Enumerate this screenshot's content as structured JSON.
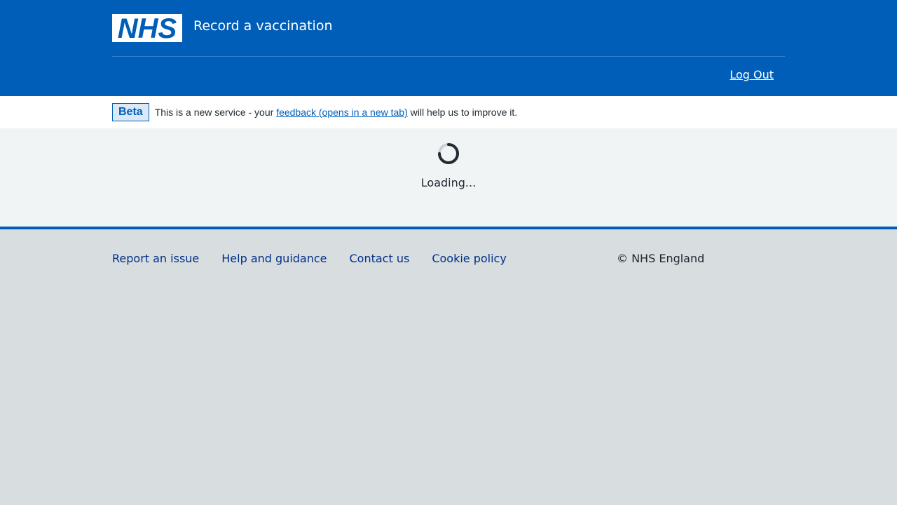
{
  "header": {
    "logo_text": "NHS",
    "service_name": "Record a vaccination",
    "logout_label": "Log Out"
  },
  "beta": {
    "tag": "Beta",
    "text_before": "This is a new service - your ",
    "link_text": "feedback (opens in a new tab)",
    "text_after": " will help us to improve it."
  },
  "main": {
    "loading_text": "Loading..."
  },
  "footer": {
    "links": [
      "Report an issue",
      "Help and guidance",
      "Contact us",
      "Cookie policy"
    ],
    "copyright": "© NHS England"
  },
  "colors": {
    "nhs_blue": "#005eb8",
    "footer_bg": "#d8dde0",
    "main_bg": "#f0f4f5",
    "link_dark": "#003087"
  }
}
